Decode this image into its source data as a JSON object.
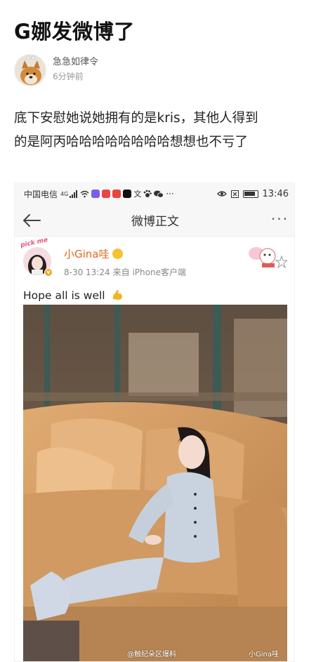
{
  "post": {
    "title": "G娜发微博了",
    "author_name": "急急如律令",
    "time": "6分钟前",
    "body_line1": "底下安慰她说她拥有的是kris，其他人得到",
    "body_line2": "的是阿丙哈哈哈哈哈哈哈哈想想也不亏了"
  },
  "screenshot": {
    "status": {
      "carrier": "中国电信",
      "signal": "4G",
      "dots": "···",
      "time": "13:46"
    },
    "nav": {
      "title": "微博正文",
      "more": "···"
    },
    "weibo": {
      "user": "小Gina哇",
      "date": "8-30 13:24",
      "source": "来自 iPhone客户端",
      "text": "Hope all is well",
      "avatar_sticker": "pick me"
    },
    "watermarks": {
      "left": "@触纪朵区爆料",
      "right": "小Gina哇"
    }
  },
  "colors": {
    "username": "#e8641b",
    "background": "#ffffff",
    "sofa": "#d9a066"
  }
}
